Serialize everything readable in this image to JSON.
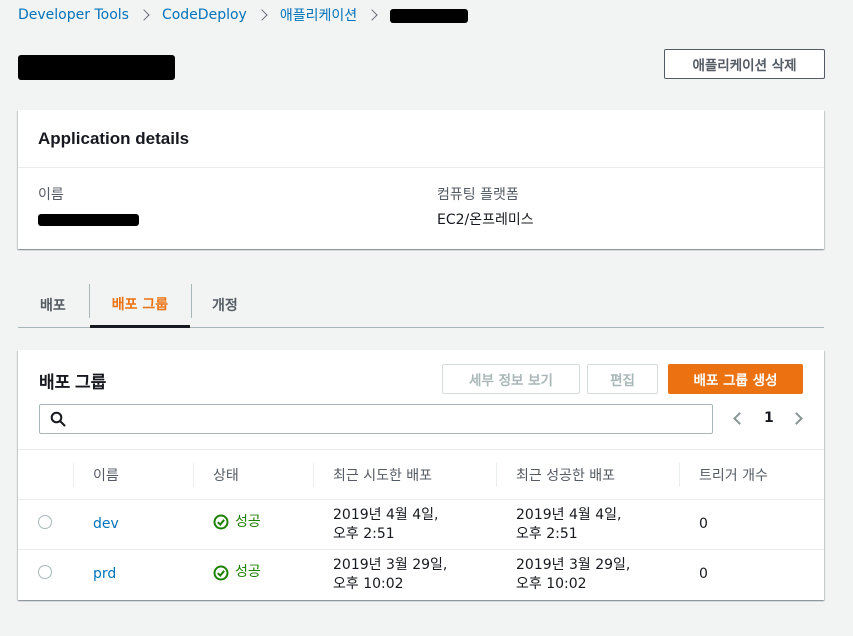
{
  "breadcrumb": {
    "items": [
      "Developer Tools",
      "CodeDeploy",
      "애플리케이션"
    ]
  },
  "header": {
    "delete_button": "애플리케이션 삭제"
  },
  "details": {
    "title": "Application details",
    "name_label": "이름",
    "platform_label": "컴퓨팅 플랫폼",
    "platform_value": "EC2/온프레미스"
  },
  "tabs": {
    "items": [
      {
        "label": "배포"
      },
      {
        "label": "배포 그룹"
      },
      {
        "label": "개정"
      }
    ],
    "active_index": 1
  },
  "groups": {
    "title": "배포 그룹",
    "view_details_button": "세부 정보 보기",
    "edit_button": "편집",
    "create_button": "배포 그룹 생성",
    "search_placeholder": "",
    "page": "1",
    "columns": [
      "이름",
      "상태",
      "최근 시도한 배포",
      "최근 성공한 배포",
      "트리거 개수"
    ],
    "rows": [
      {
        "name": "dev",
        "status": "성공",
        "last_attempted": "2019년 4월 4일,\n오후 2:51",
        "last_attempted_l1": "2019년 4월 4일,",
        "last_attempted_l2": "오후 2:51",
        "last_success_l1": "2019년 4월 4일,",
        "last_success_l2": "오후 2:51",
        "trigger_count": "0"
      },
      {
        "name": "prd",
        "status": "성공",
        "last_attempted_l1": "2019년 3월 29일,",
        "last_attempted_l2": "오후 10:02",
        "last_success_l1": "2019년 3월 29일,",
        "last_success_l2": "오후 10:02",
        "trigger_count": "0"
      }
    ]
  },
  "colors": {
    "accent": "#ec7211",
    "link": "#0073bb",
    "success": "#1d8102"
  }
}
